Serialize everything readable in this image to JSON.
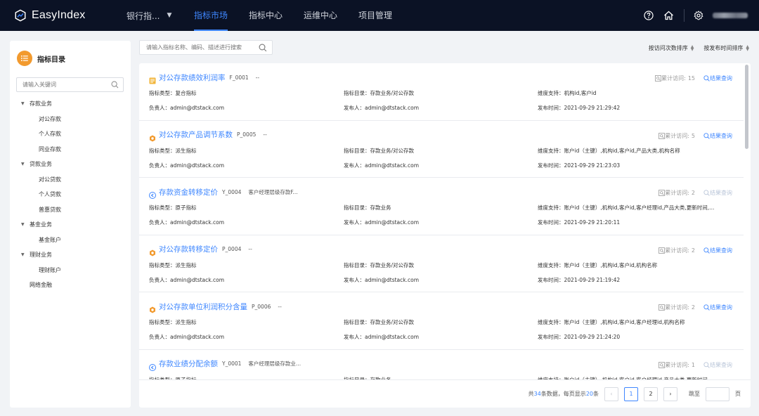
{
  "app": {
    "name": "EasyIndex",
    "project": "银行指...",
    "nav": [
      "指标市场",
      "指标中心",
      "运维中心",
      "项目管理"
    ],
    "active_nav": 0
  },
  "sidebar": {
    "title": "指标目录",
    "search_placeholder": "请输入关键词",
    "tree": [
      {
        "label": "存款业务",
        "type": "parent"
      },
      {
        "label": "对公存款",
        "type": "child"
      },
      {
        "label": "个人存款",
        "type": "child"
      },
      {
        "label": "同业存款",
        "type": "child"
      },
      {
        "label": "贷款业务",
        "type": "parent"
      },
      {
        "label": "对公贷款",
        "type": "child"
      },
      {
        "label": "个人贷款",
        "type": "child"
      },
      {
        "label": "普惠贷款",
        "type": "child"
      },
      {
        "label": "基金业务",
        "type": "parent"
      },
      {
        "label": "基金账户",
        "type": "child"
      },
      {
        "label": "理财业务",
        "type": "parent"
      },
      {
        "label": "理财账户",
        "type": "child"
      },
      {
        "label": "网络金融",
        "type": "flat"
      }
    ]
  },
  "main": {
    "search_placeholder": "请输入指标名称、编码、描述进行搜索",
    "sort_by_visits": "按访问次数排序",
    "sort_by_time": "按发布时间排序"
  },
  "colors": {
    "accent": "#3f87ff",
    "topbar": "#0b1225",
    "composite_icon": "#f2b53a",
    "derived_icon": "#f29a2e",
    "atomic_icon": "#3f87ff"
  },
  "cards": [
    {
      "icon": "composite-icon",
      "name": "对公存款绩效利润率",
      "code": "F_0001",
      "desc": "--",
      "visits_label": "累计访问:",
      "visits": "15",
      "query_label": "结果查询",
      "query_enabled": true,
      "type": "指标类型：复合指标",
      "catalog": "指标目录：存款业务/对公存款",
      "dims": "维度支持：机构id,客户id",
      "owner": "负责人：admin@dtstack.com",
      "publisher": "发布人：admin@dtstack.com",
      "time": "发布时间：2021-09-29 21:29:42"
    },
    {
      "icon": "derived-icon",
      "name": "对公存款产品调节系数",
      "code": "P_0005",
      "desc": "--",
      "visits_label": "累计访问:",
      "visits": "5",
      "query_label": "结果查询",
      "query_enabled": true,
      "type": "指标类型：派生指标",
      "catalog": "指标目录：存款业务/对公存款",
      "dims": "维度支持：账户id（主键）,机构id,客户id,产品大类,机构名称",
      "owner": "负责人：admin@dtstack.com",
      "publisher": "发布人：admin@dtstack.com",
      "time": "发布时间：2021-09-29 21:23:03"
    },
    {
      "icon": "atomic-icon",
      "name": "存款资金转移定价",
      "code": "Y_0004",
      "desc": "客户经理层级存款F...",
      "visits_label": "累计访问:",
      "visits": "2",
      "query_label": "结果查询",
      "query_enabled": false,
      "type": "指标类型：原子指标",
      "catalog": "指标目录：存款业务",
      "dims": "维度支持：账户id（主键）,机构id,客户id,客户经理id,产品大类,更新时间,...",
      "owner": "负责人：admin@dtstack.com",
      "publisher": "发布人：admin@dtstack.com",
      "time": "发布时间：2021-09-29 21:20:11"
    },
    {
      "icon": "derived-icon",
      "name": "对公存款转移定价",
      "code": "P_0004",
      "desc": "--",
      "visits_label": "累计访问:",
      "visits": "2",
      "query_label": "结果查询",
      "query_enabled": true,
      "type": "指标类型：派生指标",
      "catalog": "指标目录：存款业务/对公存款",
      "dims": "维度支持：账户id（主键）,机构id,客户id,机构名称",
      "owner": "负责人：admin@dtstack.com",
      "publisher": "发布人：admin@dtstack.com",
      "time": "发布时间：2021-09-29 21:19:42"
    },
    {
      "icon": "derived-icon",
      "name": "对公存款单位利润积分含量",
      "code": "P_0006",
      "desc": "--",
      "visits_label": "累计访问:",
      "visits": "2",
      "query_label": "结果查询",
      "query_enabled": true,
      "type": "指标类型：派生指标",
      "catalog": "指标目录：存款业务/对公存款",
      "dims": "维度支持：账户id（主键）,机构id,客户id,客户经理id,机构名称",
      "owner": "负责人：admin@dtstack.com",
      "publisher": "发布人：admin@dtstack.com",
      "time": "发布时间：2021-09-29 21:24:20"
    },
    {
      "icon": "atomic-icon",
      "name": "存款业绩分配余额",
      "code": "Y_0001",
      "desc": "客户经理层级存款业...",
      "visits_label": "累计访问:",
      "visits": "1",
      "query_label": "结果查询",
      "query_enabled": false,
      "type": "指标类型：原子指标",
      "catalog": "指标目录：存款业务",
      "dims": "维度支持：账户id（主键）,机构id,客户id,客户经理id,产品大类,更新时间",
      "owner": "",
      "publisher": "",
      "time": ""
    }
  ],
  "pager": {
    "prefix": "共",
    "total": "34",
    "middle": "条数据，每页显示",
    "page_size": "20",
    "suffix": "条",
    "pages": [
      "1",
      "2"
    ],
    "current": "1",
    "jump_label": "跳至",
    "page_unit": "页"
  }
}
